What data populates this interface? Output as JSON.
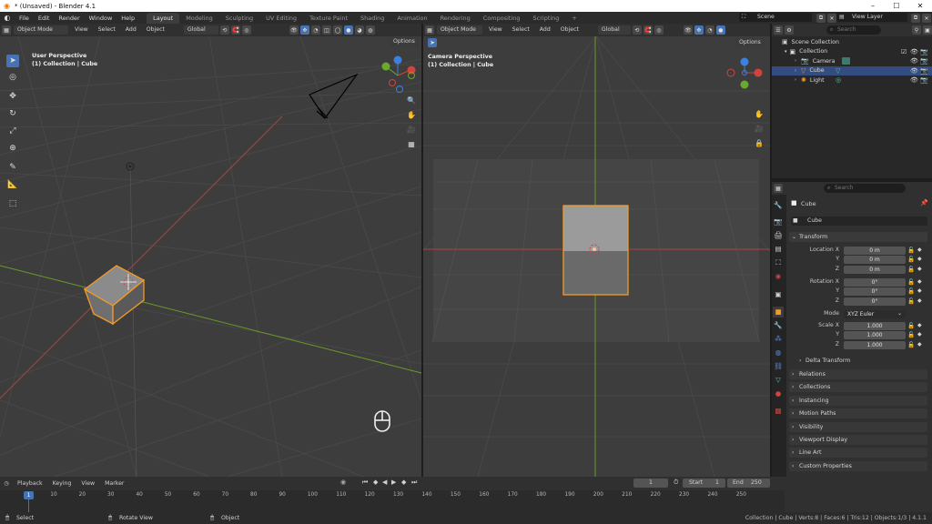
{
  "window": {
    "title": "* (Unsaved) - Blender 4.1",
    "controls": [
      "–",
      "☐",
      "✕"
    ]
  },
  "menu": [
    "File",
    "Edit",
    "Render",
    "Window",
    "Help"
  ],
  "workspaces": [
    "Layout",
    "Modeling",
    "Sculpting",
    "UV Editing",
    "Texture Paint",
    "Shading",
    "Animation",
    "Rendering",
    "Compositing",
    "Scripting"
  ],
  "active_workspace": "Layout",
  "scene": {
    "scene_name": "Scene",
    "view_layer": "View Layer"
  },
  "viewport_left": {
    "mode": "Object Mode",
    "menus": [
      "View",
      "Select",
      "Add",
      "Object"
    ],
    "orientation": "Global",
    "options": "Options",
    "label_line1": "User Perspective",
    "label_line2": "(1) Collection | Cube"
  },
  "viewport_right": {
    "mode": "Object Mode",
    "menus": [
      "View",
      "Select",
      "Add",
      "Object"
    ],
    "orientation": "Global",
    "options": "Options",
    "label_line1": "Camera Perspective",
    "label_line2": "(1) Collection | Cube"
  },
  "outliner": {
    "search_placeholder": "Search",
    "rows": [
      {
        "label": "Scene Collection",
        "indent": 0,
        "selected": false,
        "visible_toggles": false
      },
      {
        "label": "Collection",
        "indent": 1,
        "selected": false,
        "visible_toggles": true
      },
      {
        "label": "Camera",
        "indent": 2,
        "selected": false,
        "visible_toggles": true
      },
      {
        "label": "Cube",
        "indent": 2,
        "selected": true,
        "visible_toggles": true
      },
      {
        "label": "Light",
        "indent": 2,
        "selected": false,
        "visible_toggles": true
      }
    ]
  },
  "properties": {
    "search_placeholder": "Search",
    "object_name": "Cube",
    "object_field": "Cube",
    "transform_header": "Transform",
    "location": {
      "label": "Location X",
      "x": "0 m",
      "y": "0 m",
      "z": "0 m"
    },
    "rotation": {
      "label": "Rotation X",
      "x": "0°",
      "y": "0°",
      "z": "0°"
    },
    "mode_label": "Mode",
    "mode_value": "XYZ Euler",
    "scale": {
      "label": "Scale X",
      "x": "1.000",
      "y": "1.000",
      "z": "1.000"
    },
    "axis_y": "Y",
    "axis_z": "Z",
    "delta_transform": "Delta Transform",
    "panels": [
      "Relations",
      "Collections",
      "Instancing",
      "Motion Paths",
      "Visibility",
      "Viewport Display",
      "Line Art",
      "Custom Properties"
    ]
  },
  "timeline": {
    "menus": [
      "Playback",
      "Keying",
      "View",
      "Marker"
    ],
    "current_frame": "1",
    "start_label": "Start",
    "start_value": "1",
    "end_label": "End",
    "end_value": "250",
    "playhead": "1",
    "ticks": [
      "10",
      "20",
      "30",
      "40",
      "50",
      "60",
      "70",
      "80",
      "90",
      "100",
      "110",
      "120",
      "130",
      "140",
      "150",
      "160",
      "170",
      "180",
      "190",
      "200",
      "210",
      "220",
      "230",
      "240",
      "250"
    ]
  },
  "statusbar": {
    "hint_select": "Select",
    "hint_rotate": "Rotate View",
    "hint_object": "Object",
    "stats": "Collection | Cube | Verts:8 | Faces:6 | Tris:12 | Objects:1/3 | 4.1.1"
  },
  "colors": {
    "accent": "#4772b3",
    "selection_orange": "#f39a26",
    "x_axis": "#d0443b",
    "y_axis": "#6aa82e",
    "z_axis": "#3b82e0"
  }
}
